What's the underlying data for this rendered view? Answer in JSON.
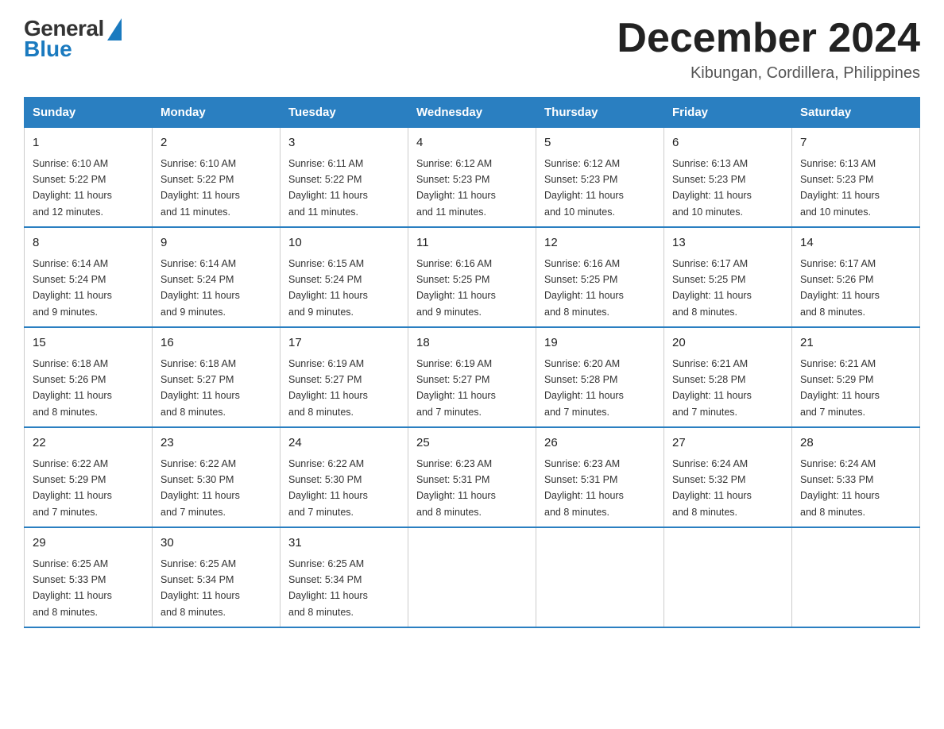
{
  "logo": {
    "general": "General",
    "blue": "Blue"
  },
  "title": "December 2024",
  "location": "Kibungan, Cordillera, Philippines",
  "weekdays": [
    "Sunday",
    "Monday",
    "Tuesday",
    "Wednesday",
    "Thursday",
    "Friday",
    "Saturday"
  ],
  "weeks": [
    [
      {
        "day": "1",
        "sunrise": "6:10 AM",
        "sunset": "5:22 PM",
        "daylight": "11 hours and 12 minutes."
      },
      {
        "day": "2",
        "sunrise": "6:10 AM",
        "sunset": "5:22 PM",
        "daylight": "11 hours and 11 minutes."
      },
      {
        "day": "3",
        "sunrise": "6:11 AM",
        "sunset": "5:22 PM",
        "daylight": "11 hours and 11 minutes."
      },
      {
        "day": "4",
        "sunrise": "6:12 AM",
        "sunset": "5:23 PM",
        "daylight": "11 hours and 11 minutes."
      },
      {
        "day": "5",
        "sunrise": "6:12 AM",
        "sunset": "5:23 PM",
        "daylight": "11 hours and 10 minutes."
      },
      {
        "day": "6",
        "sunrise": "6:13 AM",
        "sunset": "5:23 PM",
        "daylight": "11 hours and 10 minutes."
      },
      {
        "day": "7",
        "sunrise": "6:13 AM",
        "sunset": "5:23 PM",
        "daylight": "11 hours and 10 minutes."
      }
    ],
    [
      {
        "day": "8",
        "sunrise": "6:14 AM",
        "sunset": "5:24 PM",
        "daylight": "11 hours and 9 minutes."
      },
      {
        "day": "9",
        "sunrise": "6:14 AM",
        "sunset": "5:24 PM",
        "daylight": "11 hours and 9 minutes."
      },
      {
        "day": "10",
        "sunrise": "6:15 AM",
        "sunset": "5:24 PM",
        "daylight": "11 hours and 9 minutes."
      },
      {
        "day": "11",
        "sunrise": "6:16 AM",
        "sunset": "5:25 PM",
        "daylight": "11 hours and 9 minutes."
      },
      {
        "day": "12",
        "sunrise": "6:16 AM",
        "sunset": "5:25 PM",
        "daylight": "11 hours and 8 minutes."
      },
      {
        "day": "13",
        "sunrise": "6:17 AM",
        "sunset": "5:25 PM",
        "daylight": "11 hours and 8 minutes."
      },
      {
        "day": "14",
        "sunrise": "6:17 AM",
        "sunset": "5:26 PM",
        "daylight": "11 hours and 8 minutes."
      }
    ],
    [
      {
        "day": "15",
        "sunrise": "6:18 AM",
        "sunset": "5:26 PM",
        "daylight": "11 hours and 8 minutes."
      },
      {
        "day": "16",
        "sunrise": "6:18 AM",
        "sunset": "5:27 PM",
        "daylight": "11 hours and 8 minutes."
      },
      {
        "day": "17",
        "sunrise": "6:19 AM",
        "sunset": "5:27 PM",
        "daylight": "11 hours and 8 minutes."
      },
      {
        "day": "18",
        "sunrise": "6:19 AM",
        "sunset": "5:27 PM",
        "daylight": "11 hours and 7 minutes."
      },
      {
        "day": "19",
        "sunrise": "6:20 AM",
        "sunset": "5:28 PM",
        "daylight": "11 hours and 7 minutes."
      },
      {
        "day": "20",
        "sunrise": "6:21 AM",
        "sunset": "5:28 PM",
        "daylight": "11 hours and 7 minutes."
      },
      {
        "day": "21",
        "sunrise": "6:21 AM",
        "sunset": "5:29 PM",
        "daylight": "11 hours and 7 minutes."
      }
    ],
    [
      {
        "day": "22",
        "sunrise": "6:22 AM",
        "sunset": "5:29 PM",
        "daylight": "11 hours and 7 minutes."
      },
      {
        "day": "23",
        "sunrise": "6:22 AM",
        "sunset": "5:30 PM",
        "daylight": "11 hours and 7 minutes."
      },
      {
        "day": "24",
        "sunrise": "6:22 AM",
        "sunset": "5:30 PM",
        "daylight": "11 hours and 7 minutes."
      },
      {
        "day": "25",
        "sunrise": "6:23 AM",
        "sunset": "5:31 PM",
        "daylight": "11 hours and 8 minutes."
      },
      {
        "day": "26",
        "sunrise": "6:23 AM",
        "sunset": "5:31 PM",
        "daylight": "11 hours and 8 minutes."
      },
      {
        "day": "27",
        "sunrise": "6:24 AM",
        "sunset": "5:32 PM",
        "daylight": "11 hours and 8 minutes."
      },
      {
        "day": "28",
        "sunrise": "6:24 AM",
        "sunset": "5:33 PM",
        "daylight": "11 hours and 8 minutes."
      }
    ],
    [
      {
        "day": "29",
        "sunrise": "6:25 AM",
        "sunset": "5:33 PM",
        "daylight": "11 hours and 8 minutes."
      },
      {
        "day": "30",
        "sunrise": "6:25 AM",
        "sunset": "5:34 PM",
        "daylight": "11 hours and 8 minutes."
      },
      {
        "day": "31",
        "sunrise": "6:25 AM",
        "sunset": "5:34 PM",
        "daylight": "11 hours and 8 minutes."
      },
      null,
      null,
      null,
      null
    ]
  ],
  "labels": {
    "sunrise": "Sunrise:",
    "sunset": "Sunset:",
    "daylight": "Daylight:"
  }
}
